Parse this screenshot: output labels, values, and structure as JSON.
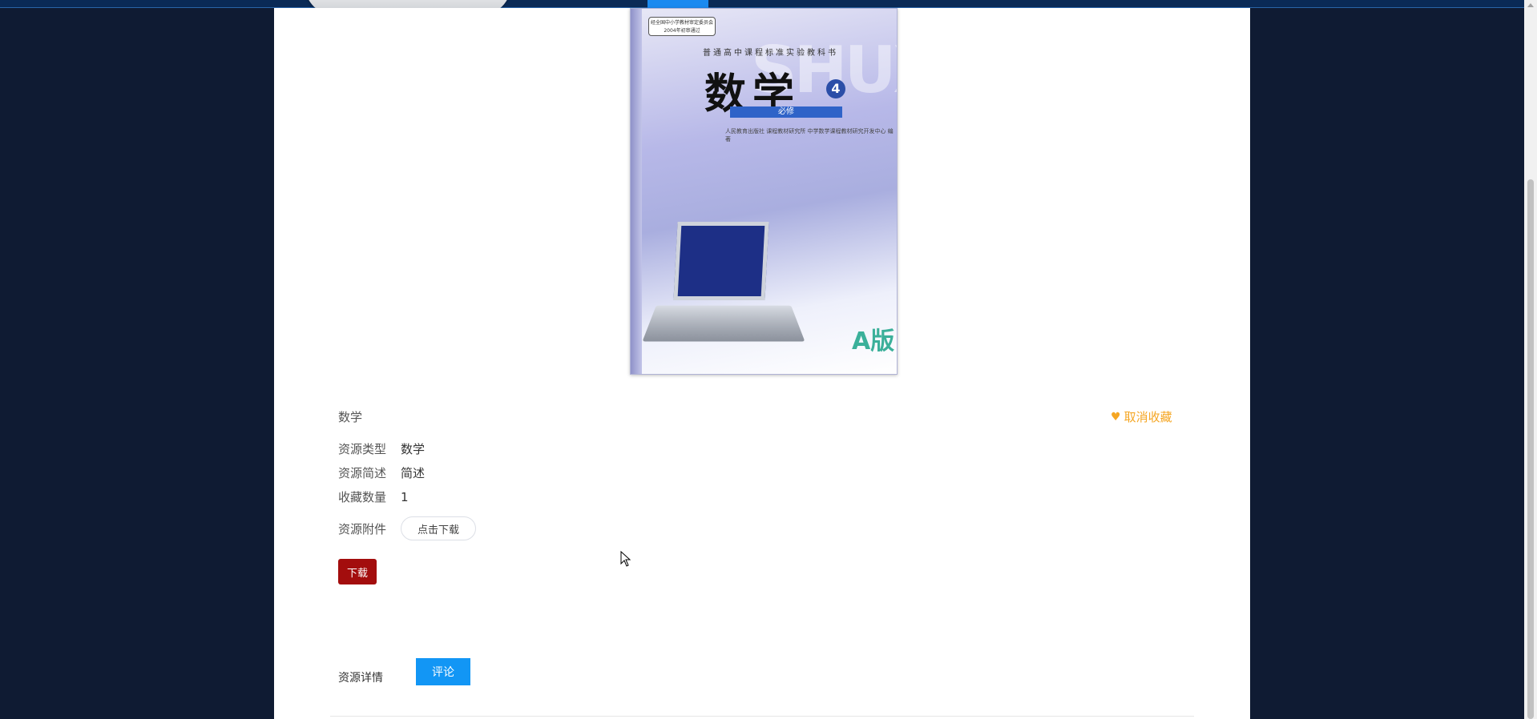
{
  "cover": {
    "badge": "经全国中小学教材审定委员会 2004年初审通过",
    "series": "普通高中课程标准实验教科书",
    "title": "数学",
    "volume": "4",
    "subtitle": "必修",
    "publisher_lines": "人民教育出版社 课程教材研究所 中学数学课程教材研究开发中心 编著",
    "edition": "A版"
  },
  "resource": {
    "name": "数学",
    "favorite_label": "取消收藏",
    "meta": [
      {
        "label": "资源类型",
        "value": "数学"
      },
      {
        "label": "资源简述",
        "value": "简述"
      },
      {
        "label": "收藏数量",
        "value": "1"
      }
    ],
    "attachment_label": "资源附件",
    "attachment_button": "点击下载",
    "download_button": "下载"
  },
  "tabs": {
    "detail": "资源详情",
    "comment": "评论"
  },
  "colors": {
    "page_bg": "#0f1b33",
    "accent_orange": "#f5a623",
    "download_red": "#a30d0d",
    "tab_blue": "#1296f5"
  },
  "icons": {
    "favorite": "heart-icon"
  }
}
